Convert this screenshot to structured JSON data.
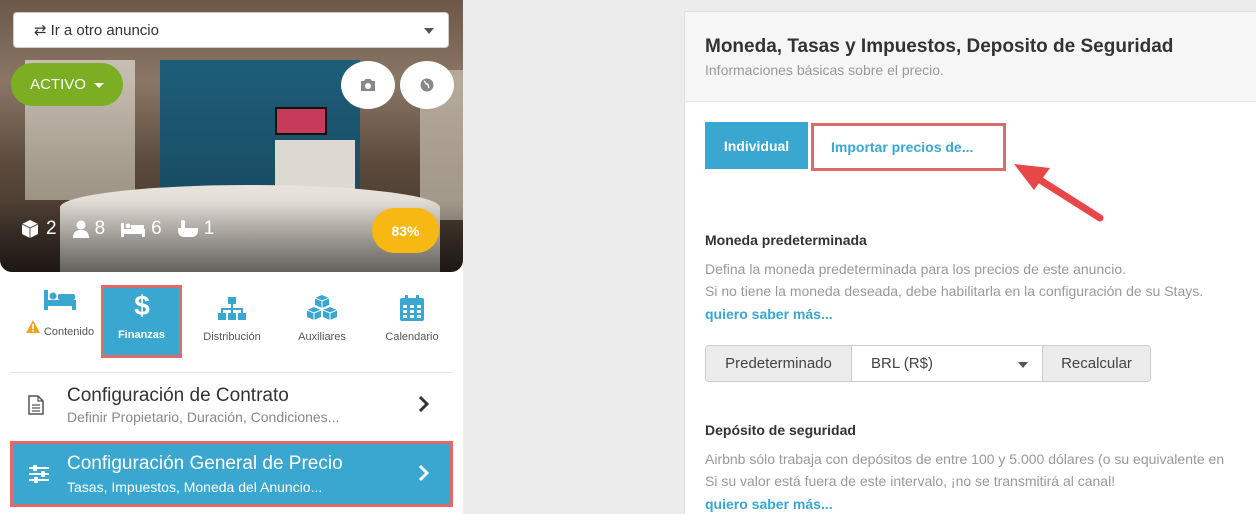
{
  "ad_selector": {
    "label": "Ir a otro anuncio"
  },
  "listing": {
    "status_label": "ACTIVO",
    "stats": {
      "rooms": "2",
      "guests": "8",
      "beds": "6",
      "baths": "1"
    },
    "score": "83%"
  },
  "tabs": [
    {
      "label": "Contenido",
      "icon": "bed-icon",
      "warning": true
    },
    {
      "label": "Finanzas",
      "icon": "dollar-icon",
      "active": true
    },
    {
      "label": "Distribución",
      "icon": "sitemap-icon"
    },
    {
      "label": "Auxiliares",
      "icon": "cubes-icon"
    },
    {
      "label": "Calendario",
      "icon": "calendar-icon"
    }
  ],
  "menu": [
    {
      "title": "Configuración de Contrato",
      "subtitle": "Definir Propietario, Duración, Condiciones...",
      "icon": "document-icon"
    },
    {
      "title": "Configuración General de Precio",
      "subtitle": "Tasas, Impuestos, Moneda del Anuncio...",
      "icon": "sliders-icon",
      "active": true
    }
  ],
  "panel": {
    "title": "Moneda, Tasas y Impuestos, Deposito de Seguridad",
    "subtitle": "Informaciones básicas sobre el precio.",
    "btn_individual": "Individual",
    "btn_import": "Importar precios de...",
    "currency": {
      "title": "Moneda predeterminada",
      "desc1": "Defina la moneda predeterminada para los precios de este anuncio.",
      "desc2": "Si no tiene la moneda deseada, debe habilitarla en la configuración de su Stays.",
      "link": "quiero saber más...",
      "default_label": "Predeterminado",
      "selected": "BRL (R$)",
      "recalc_label": "Recalcular"
    },
    "deposit": {
      "title": "Depósito de seguridad",
      "desc1": "Airbnb sólo trabaja con depósitos de entre 100 y 5.000 dólares (o su equivalente en",
      "desc2": "Si su valor está fuera de este intervalo, ¡no se transmitirá al canal!",
      "link": "quiero saber más..."
    }
  },
  "colors": {
    "accent": "#39a7cf",
    "active_green": "#7cae23",
    "score_yellow": "#f7b814",
    "highlight_red": "#e06a6a"
  }
}
